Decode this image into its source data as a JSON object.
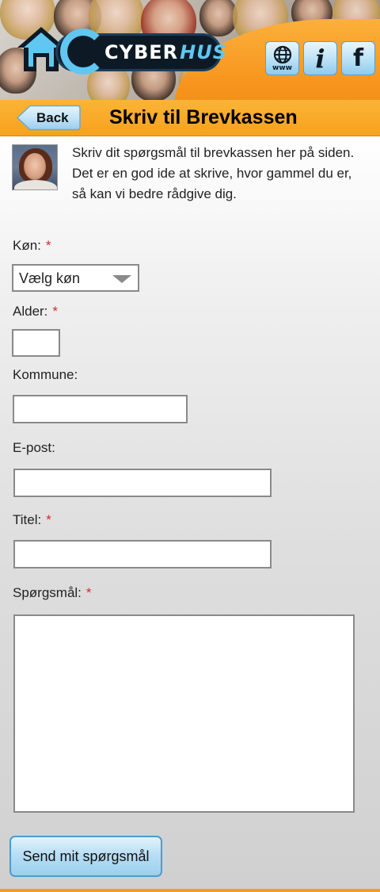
{
  "header": {
    "logo": {
      "text_prefix": "CYBER",
      "text_suffix": "HUS",
      "text_c": "C"
    },
    "icons": [
      {
        "name": "www",
        "label": "www"
      },
      {
        "name": "info",
        "label": "i"
      },
      {
        "name": "facebook",
        "label": "f"
      }
    ],
    "colors": {
      "orange": "#f7941d",
      "brand_blue": "#5fc7f2",
      "logo_dark": "#0d1a26"
    }
  },
  "titlebar": {
    "back_label": "Back",
    "title": "Skriv til Brevkassen"
  },
  "intro": {
    "text": "Skriv dit spørgsmål til brevkassen her på siden. Det er en god ide at skrive, hvor gammel du er, så kan vi bedre rådgive dig."
  },
  "form": {
    "required_marker": "*",
    "gender": {
      "label": "Køn:",
      "required": true,
      "selected": "Vælg køn"
    },
    "age": {
      "label": "Alder:",
      "required": true,
      "value": ""
    },
    "municipality": {
      "label": "Kommune:",
      "required": false,
      "value": ""
    },
    "email": {
      "label": "E-post:",
      "required": false,
      "value": ""
    },
    "title": {
      "label": "Titel:",
      "required": true,
      "value": ""
    },
    "question": {
      "label": "Spørgsmål:",
      "required": true,
      "value": ""
    },
    "submit_label": "Send mit spørgsmål"
  }
}
